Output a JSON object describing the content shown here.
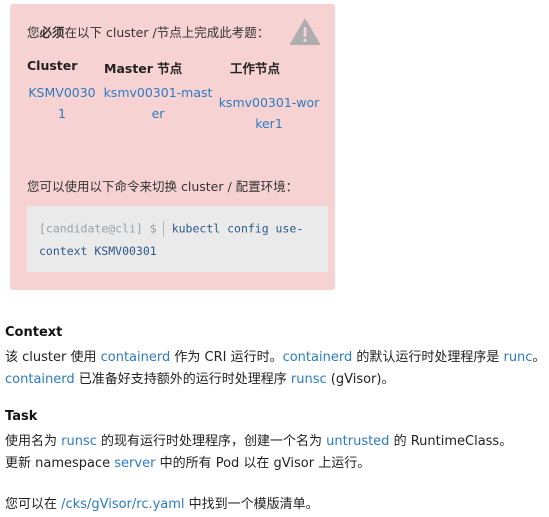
{
  "notice": {
    "title_pre": "您",
    "title_bold": "必须",
    "title_post": "在以下 cluster /节点上完成此考题：",
    "warning_icon": "warning-triangle-icon",
    "columns": [
      "Cluster",
      "Master 节点",
      "工作节点"
    ],
    "cluster_lines": [
      "KSMV0030",
      "1"
    ],
    "master_lines": [
      "ksmv00301-mast",
      "er"
    ],
    "worker_lines": [
      "ksmv00301-wor",
      "ker1"
    ],
    "switch_text": "您可以使用以下命令来切换 cluster / 配置环境：",
    "cmd_prompt": "[candidate@cli] $",
    "cmd_line1": "kubectl config use-",
    "cmd_line2": "context KSMV00301"
  },
  "context": {
    "heading": "Context",
    "l1_a": "该  cluster 使用 ",
    "l1_k1": "containerd",
    "l1_b": " 作为 CRI 运行时。",
    "l1_k2": "containerd",
    "l1_c": " 的默认运行时处理程序是 ",
    "l1_k3": "runc",
    "l1_d": "。",
    "l2_k1": "containerd",
    "l2_a": " 已准备好支持额外的运行时处理程序 ",
    "l2_k2": "runsc",
    "l2_b": " (gVisor)。"
  },
  "task": {
    "heading": "Task",
    "l1_a": "使用名为 ",
    "l1_k1": "runsc",
    "l1_b": " 的现有运行时处理程序，创建一个名为 ",
    "l1_k2": "untrusted",
    "l1_c": "  的 RuntimeClass。",
    "l2_a": "更新  namespace ",
    "l2_k1": "server",
    "l2_b": " 中的所有 Pod 以在 gVisor 上运行。",
    "l3_a": "您可以在 ",
    "l3_k1": " /cks/gVisor/rc.yaml",
    "l3_b": " 中找到一个模版清单。"
  },
  "colors": {
    "notice_bg": "#f7d2d2",
    "link": "#2c7bc2",
    "code_bg": "#eaeaea"
  }
}
